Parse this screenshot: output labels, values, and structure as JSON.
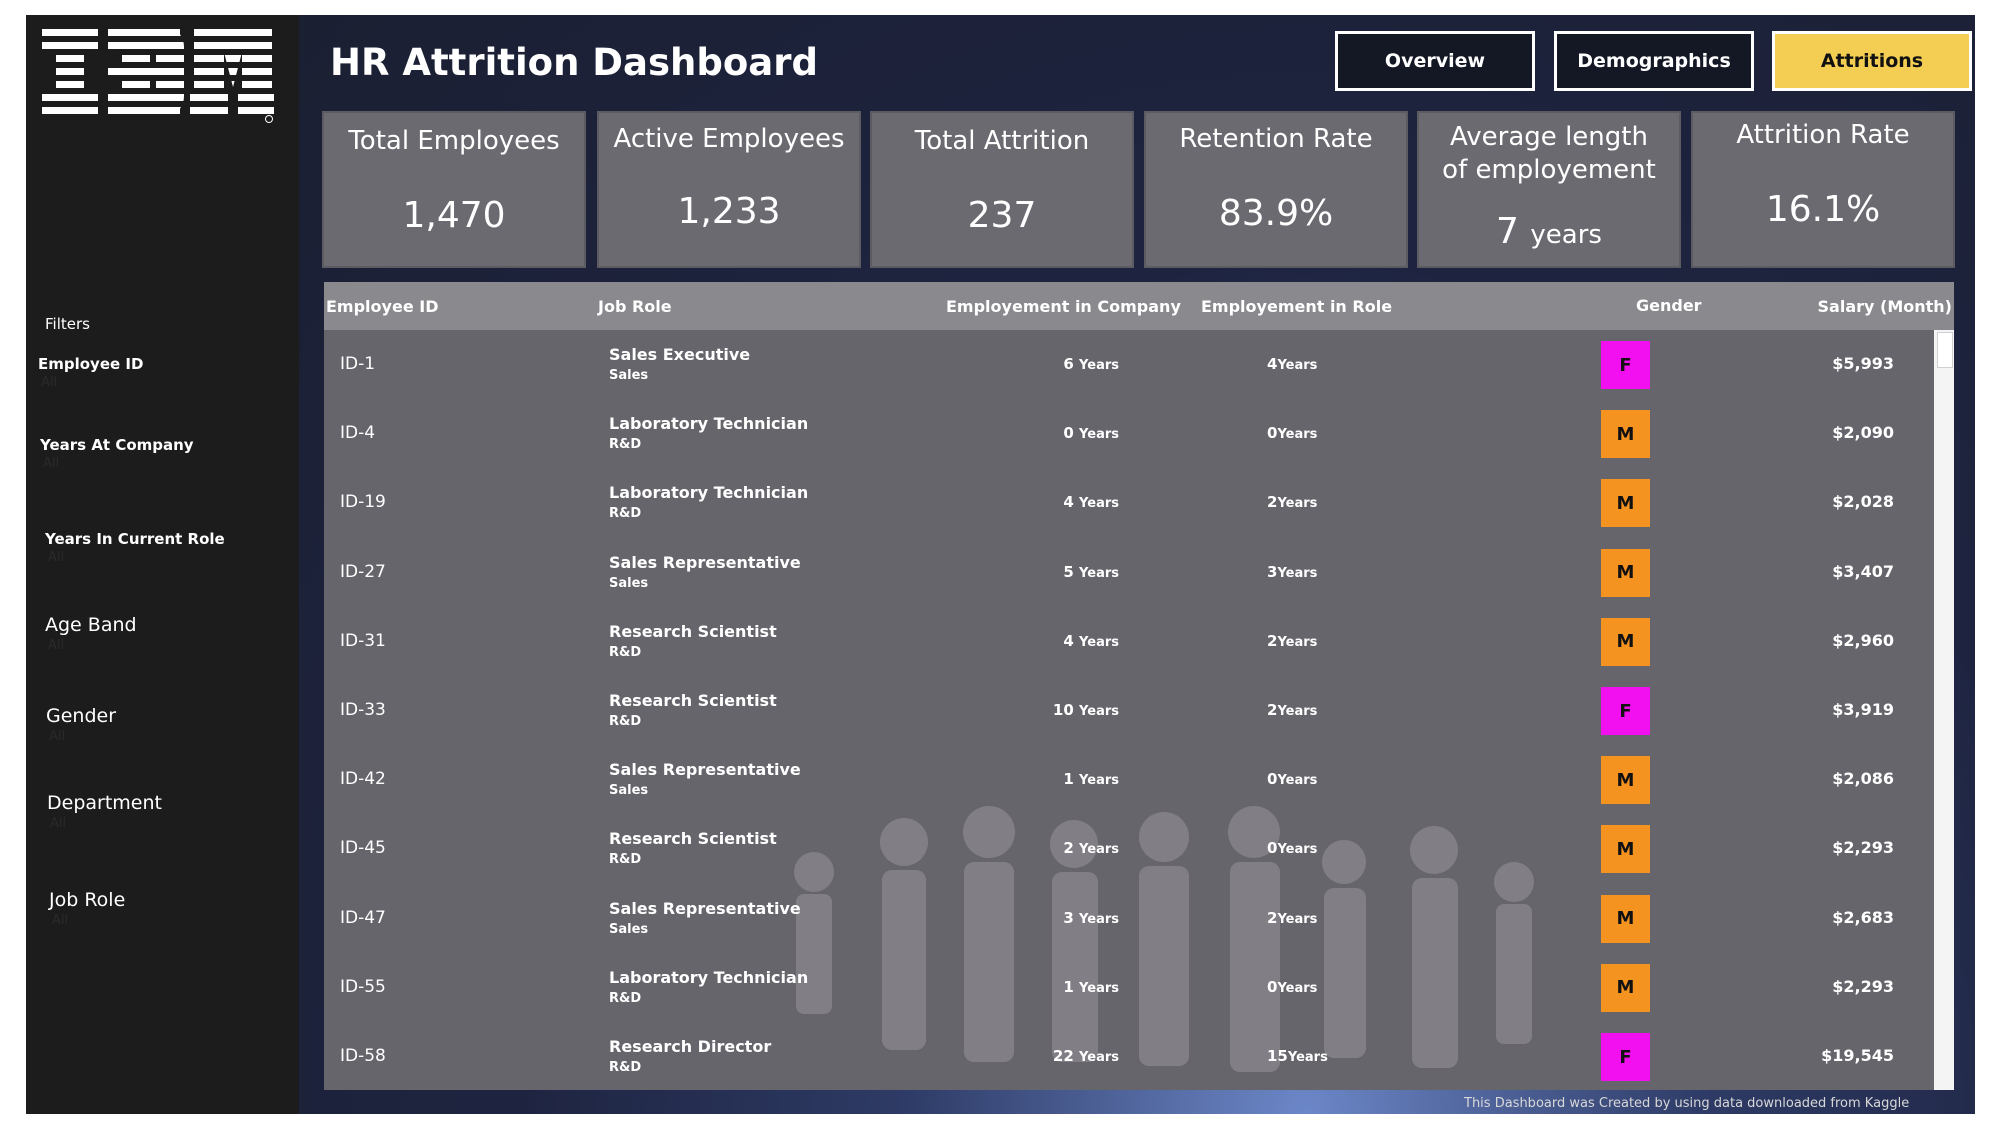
{
  "brand": {
    "logo_text": "IBM"
  },
  "sidebar": {
    "filters_title": "Filters",
    "filters": [
      {
        "label": "Employee ID",
        "value": "All"
      },
      {
        "label": "Years At Company",
        "value": "All"
      },
      {
        "label": "Years In Current Role",
        "value": "All"
      },
      {
        "label": "Age Band",
        "value": "All"
      },
      {
        "label": "Gender",
        "value": "All"
      },
      {
        "label": "Department",
        "value": "All"
      },
      {
        "label": "Job Role",
        "value": "All"
      }
    ]
  },
  "header": {
    "title": "HR Attrition Dashboard",
    "nav": [
      {
        "label": "Overview",
        "active": false
      },
      {
        "label": "Demographics",
        "active": false
      },
      {
        "label": "Attritions",
        "active": true
      }
    ]
  },
  "kpis": [
    {
      "title": "Total Employees",
      "value": "1,470"
    },
    {
      "title": "Active Employees",
      "value": "1,233"
    },
    {
      "title": "Total Attrition",
      "value": "237"
    },
    {
      "title": "Retention Rate",
      "value": "83.9%"
    },
    {
      "title": "Average length of employement",
      "value": "7",
      "unit": "years"
    },
    {
      "title": "Attrition Rate",
      "value": "16.1%"
    }
  ],
  "table": {
    "columns": [
      "Employee ID",
      "Job Role",
      "Employement in Company",
      "Employement in Role",
      "Gender",
      "Salary (Month)"
    ],
    "rows": [
      {
        "id": "ID-1",
        "role": "Sales Executive",
        "dept": "Sales",
        "company": "6",
        "company_unit": "Years",
        "in_role": "4",
        "role_unit": "Years",
        "gender": "F",
        "salary": "$5,993"
      },
      {
        "id": "ID-4",
        "role": "Laboratory Technician",
        "dept": "R&D",
        "company": "0",
        "company_unit": "Years",
        "in_role": "0",
        "role_unit": "Years",
        "gender": "M",
        "salary": "$2,090"
      },
      {
        "id": "ID-19",
        "role": "Laboratory Technician",
        "dept": "R&D",
        "company": "4",
        "company_unit": "Years",
        "in_role": "2",
        "role_unit": "Years",
        "gender": "M",
        "salary": "$2,028"
      },
      {
        "id": "ID-27",
        "role": "Sales Representative",
        "dept": "Sales",
        "company": "5",
        "company_unit": "Years",
        "in_role": "3",
        "role_unit": "Years",
        "gender": "M",
        "salary": "$3,407"
      },
      {
        "id": "ID-31",
        "role": "Research Scientist",
        "dept": "R&D",
        "company": "4",
        "company_unit": "Years",
        "in_role": "2",
        "role_unit": "Years",
        "gender": "M",
        "salary": "$2,960"
      },
      {
        "id": "ID-33",
        "role": "Research Scientist",
        "dept": "R&D",
        "company": "10",
        "company_unit": "Years",
        "in_role": "2",
        "role_unit": "Years",
        "gender": "F",
        "salary": "$3,919"
      },
      {
        "id": "ID-42",
        "role": "Sales Representative",
        "dept": "Sales",
        "company": "1",
        "company_unit": "Years",
        "in_role": "0",
        "role_unit": "Years",
        "gender": "M",
        "salary": "$2,086"
      },
      {
        "id": "ID-45",
        "role": "Research Scientist",
        "dept": "R&D",
        "company": "2",
        "company_unit": "Years",
        "in_role": "0",
        "role_unit": "Years",
        "gender": "M",
        "salary": "$2,293"
      },
      {
        "id": "ID-47",
        "role": "Sales Representative",
        "dept": "Sales",
        "company": "3",
        "company_unit": "Years",
        "in_role": "2",
        "role_unit": "Years",
        "gender": "M",
        "salary": "$2,683"
      },
      {
        "id": "ID-55",
        "role": "Laboratory Technician",
        "dept": "R&D",
        "company": "1",
        "company_unit": "Years",
        "in_role": "0",
        "role_unit": "Years",
        "gender": "M",
        "salary": "$2,293"
      },
      {
        "id": "ID-58",
        "role": "Research Director",
        "dept": "R&D",
        "company": "22",
        "company_unit": "Years",
        "in_role": "15",
        "role_unit": "Years",
        "gender": "F",
        "salary": "$19,545"
      }
    ]
  },
  "colors": {
    "female": "#f20ff0",
    "male": "#f49320",
    "active_nav": "#f3ce52"
  },
  "footer": {
    "note": "This Dashboard was Created by using data downloaded from Kaggle"
  }
}
